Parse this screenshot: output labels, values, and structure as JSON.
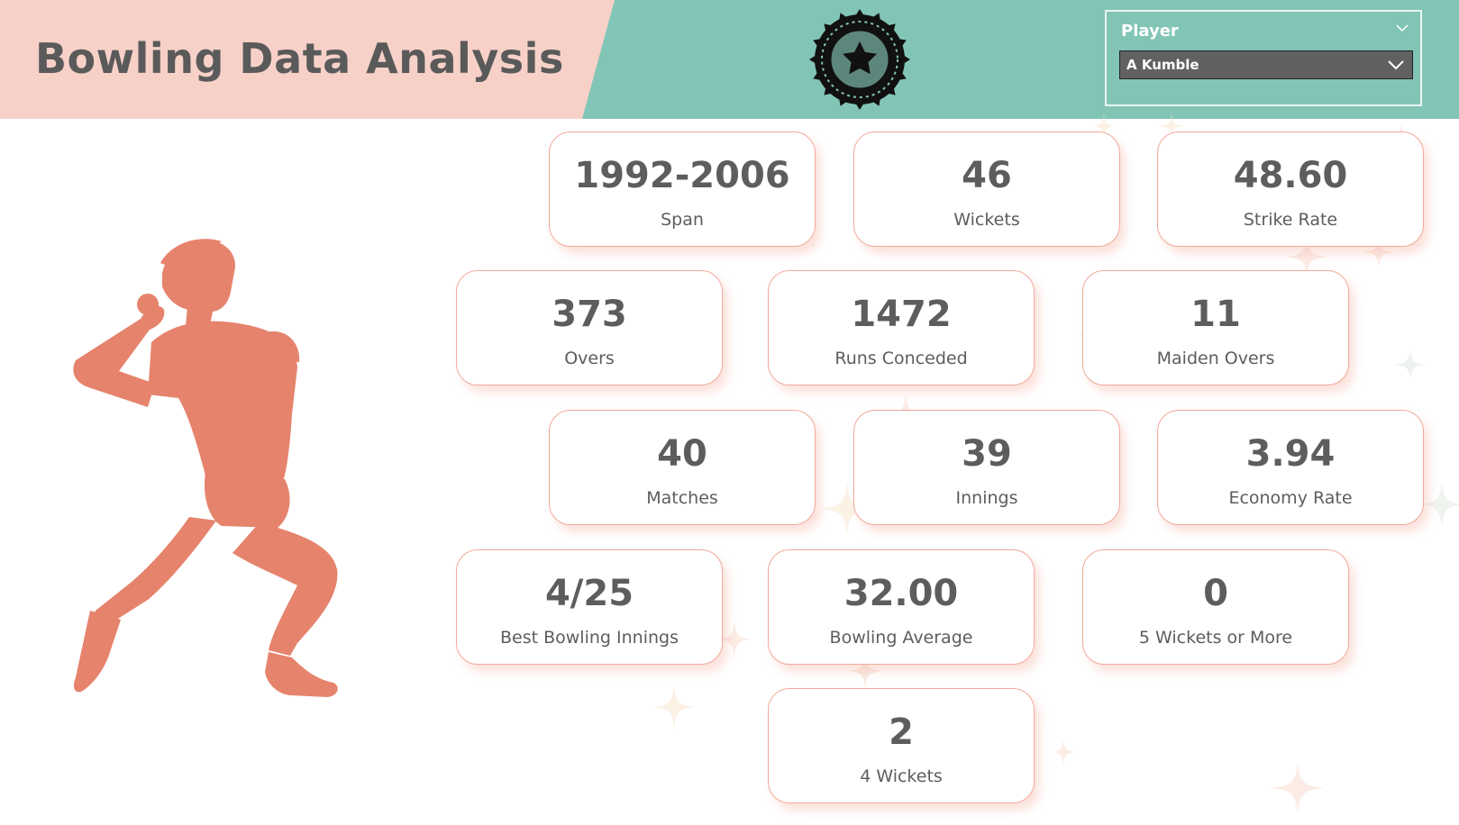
{
  "header": {
    "title": "Bowling Data Analysis"
  },
  "logo": {
    "icon": "star-badge-icon"
  },
  "slicer": {
    "title": "Player",
    "selected": "A Kumble",
    "icons": [
      "chevron-down-icon",
      "chevron-down-icon"
    ]
  },
  "illustration": {
    "icon": "cricket-bowler-icon",
    "color": "#e6836c"
  },
  "cards": [
    {
      "value": "1992-2006",
      "label": "Span"
    },
    {
      "value": "46",
      "label": "Wickets"
    },
    {
      "value": "48.60",
      "label": "Strike Rate"
    },
    {
      "value": "373",
      "label": "Overs"
    },
    {
      "value": "1472",
      "label": "Runs Conceded"
    },
    {
      "value": "11",
      "label": "Maiden Overs"
    },
    {
      "value": "40",
      "label": "Matches"
    },
    {
      "value": "39",
      "label": "Innings"
    },
    {
      "value": "3.94",
      "label": "Economy Rate"
    },
    {
      "value": "4/25",
      "label": "Best Bowling Innings"
    },
    {
      "value": "32.00",
      "label": "Bowling Average"
    },
    {
      "value": "0",
      "label": "5 Wickets or More"
    },
    {
      "value": "2",
      "label": "4 Wickets"
    }
  ],
  "colors": {
    "header_pink": "#f7d1c8",
    "header_teal": "#82c5b6",
    "card_border": "#f2a99a",
    "text": "#5d5d5d"
  }
}
